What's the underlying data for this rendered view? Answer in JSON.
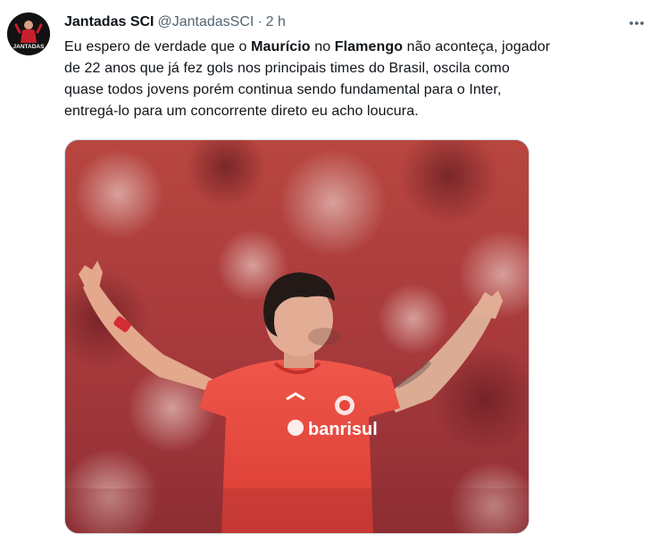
{
  "tweet": {
    "author": {
      "display_name": "Jantadas SCI",
      "handle": "@JantadasSCI",
      "avatar_text": "JANTADAS"
    },
    "separator": "·",
    "time": "2 h",
    "more_icon": "more-horizontal-icon",
    "text": {
      "l1_a": "Eu espero de verdade que o ",
      "l1_b": "Maurício",
      "l1_c": " no ",
      "l1_d": "Flamengo",
      "l1_e": " não aconteça, jogador",
      "l2": "de 22 anos que já fez gols nos principais times do Brasil, oscila como",
      "l3": "quase todos jovens porém continua sendo fundamental para o Inter,",
      "l4": "entregá-lo  para um concorrente direto eu acho loucura."
    },
    "media": {
      "sponsor_text": "banrisul",
      "jersey_color": "#e8473a",
      "crowd_color": "#b0353a"
    }
  }
}
